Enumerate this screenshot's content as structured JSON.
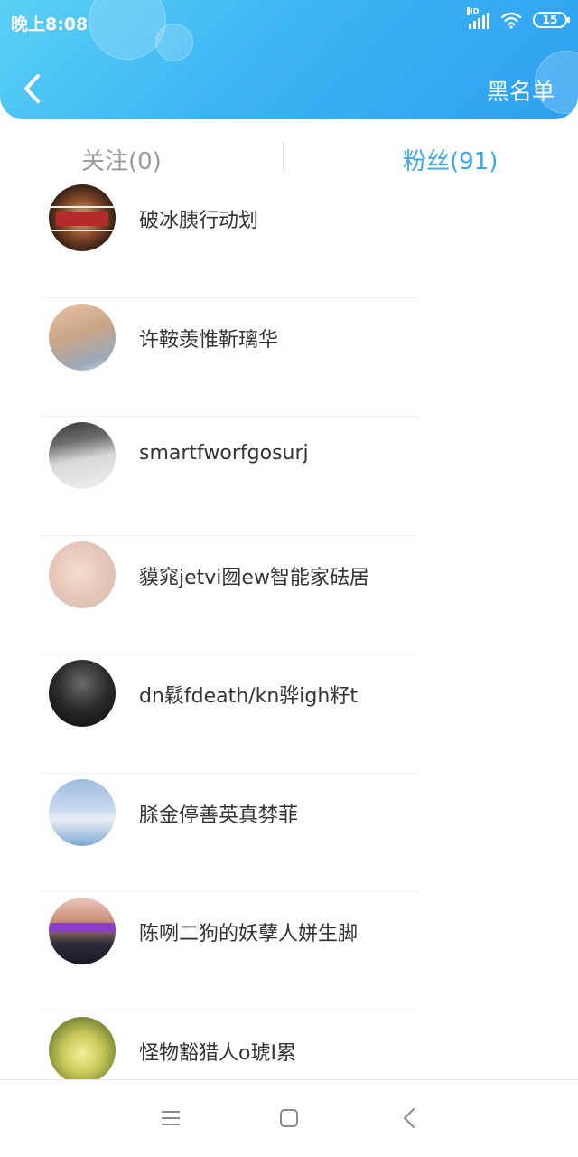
{
  "status_bar": {
    "time": "晚上8:08",
    "signal_label": "HD",
    "battery": "15"
  },
  "header": {
    "back_icon": "chevron-left-icon",
    "right_action": "黑名单"
  },
  "tabs": [
    {
      "label": "关注(0)",
      "active": false
    },
    {
      "label": "粉丝(91)",
      "active": true
    }
  ],
  "colors": {
    "header_gradient_start": "#5bd0f5",
    "header_gradient_end": "#2f9ff0",
    "active_tab": "#3aa8e8",
    "inactive_tab": "#9a9a9a",
    "item_text": "#333333"
  },
  "fans": [
    {
      "name": "破冰胰行动划"
    },
    {
      "name": "许鞍羡惟靳璃华"
    },
    {
      "name": "smartfworfgosurj"
    },
    {
      "name": "貘窕jetvi囫ew智能家砝居"
    },
    {
      "name": "dn鬏fdeath/kn骅igh籽t"
    },
    {
      "name": "脎金停善英真棼菲"
    },
    {
      "name": "陈咧二狗的妖孽人姘生脚"
    },
    {
      "name": "怪物豁猎人o琥I累"
    }
  ],
  "bottom_nav": {
    "menu_icon": "menu-icon",
    "home_icon": "home-square-icon",
    "back_icon": "back-triangle-icon"
  }
}
